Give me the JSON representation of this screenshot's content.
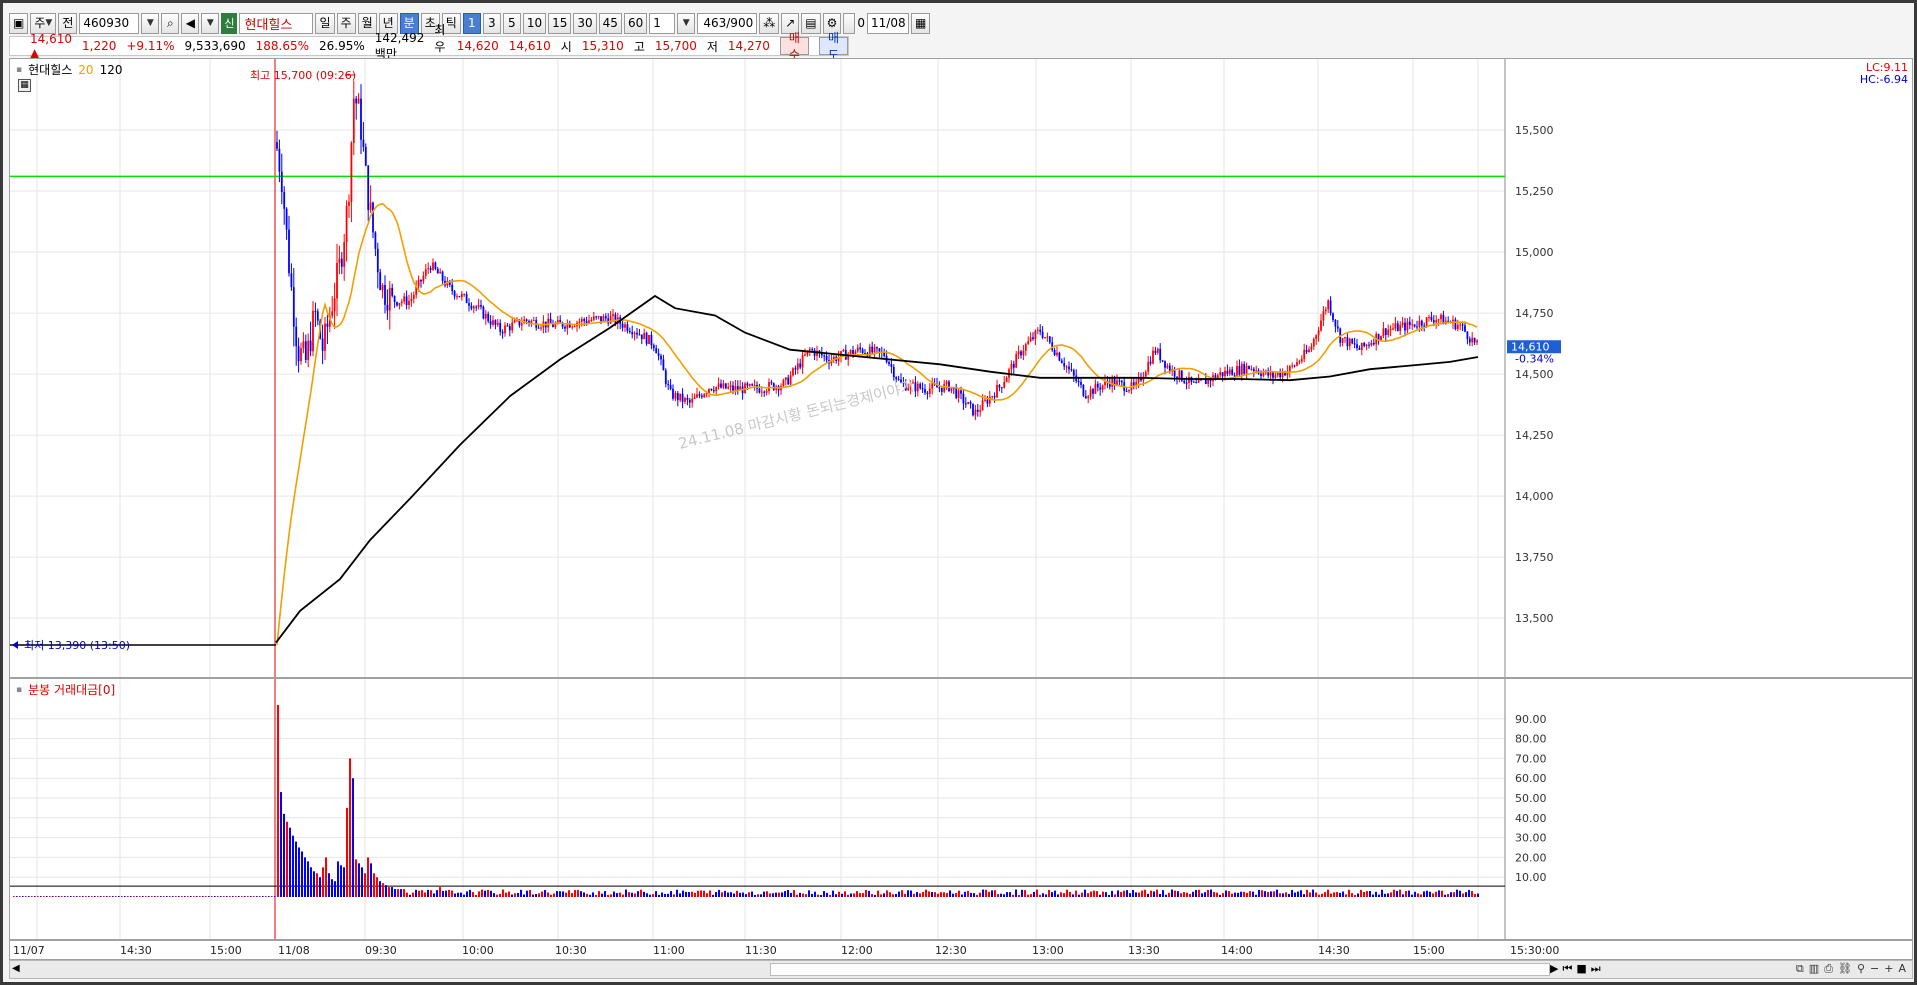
{
  "toolbar": {
    "items": [
      "주",
      "전",
      "460930",
      "신",
      "현대힐스",
      "일",
      "주",
      "월",
      "년",
      "분",
      "초",
      "틱",
      "1",
      "3",
      "5",
      "10",
      "15",
      "30",
      "45",
      "60",
      "1",
      "463",
      "/900",
      "0",
      "11/08"
    ]
  },
  "infobar": {
    "price": "14,610",
    "change": "1,220",
    "change_pct": "+9.11%",
    "volume": "9,533,690",
    "vol_ratio": "188.65%",
    "turnover": "26.95%",
    "amount": "142,492백만",
    "best_ask_label": "최우선",
    "best_ask": "14,620",
    "best_bid": "14,610",
    "open_label": "시",
    "open": "15,310",
    "high_label": "고",
    "high": "15,700",
    "low_label": "저",
    "low": "14,270",
    "buy": "매수",
    "sell": "매도"
  },
  "price_pane": {
    "legend_name": "현대힐스",
    "ma1": "20",
    "ma2": "120",
    "lc": "LC:9.11",
    "hc": "HC:-6.94",
    "high_marker": "최고 15,700 (09:26)",
    "low_marker": "최저 13,390 (13:50)",
    "last_price": "14,610",
    "last_pct": "-0.34%",
    "watermark": "24.11.08 마감시황 돈되는경제이야기",
    "yticks": [
      "15,500",
      "15,250",
      "15,000",
      "14,750",
      "14,500",
      "14,250",
      "14,000",
      "13,750",
      "13,500"
    ]
  },
  "volume_pane": {
    "title": "분봉 거래대금[0]",
    "yticks": [
      "90.00",
      "80.00",
      "70.00",
      "60.00",
      "50.00",
      "40.00",
      "30.00",
      "20.00",
      "10.00"
    ]
  },
  "xaxis": {
    "labels": [
      "11/07",
      "14:30",
      "15:00",
      "11/08",
      "09:30",
      "10:00",
      "10:30",
      "11:00",
      "11:30",
      "12:00",
      "12:30",
      "13:00",
      "13:30",
      "14:00",
      "14:30",
      "15:00",
      "15:30:00"
    ]
  },
  "chart_data": {
    "type": "candlestick",
    "ylim": [
      13300,
      15750
    ],
    "reference_line": 15310,
    "high": 15700,
    "low": 13390,
    "last": 14610,
    "volume_ylim": [
      0,
      100
    ]
  },
  "colors": {
    "up": "#ff0000",
    "down": "#0000ff",
    "ma20": "#f0a000",
    "ma120": "#000000",
    "ref": "#00e000"
  }
}
